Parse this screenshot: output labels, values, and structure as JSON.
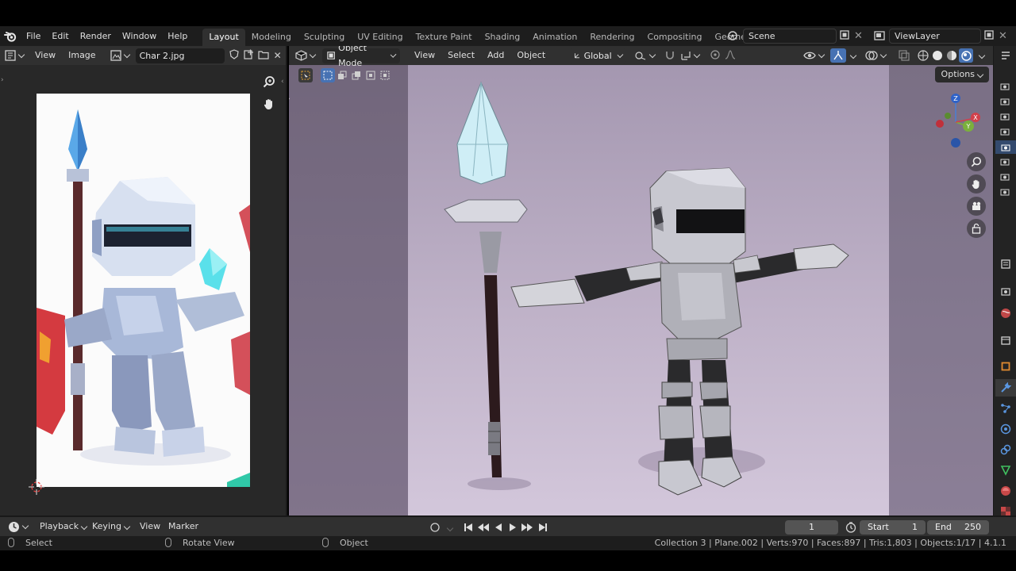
{
  "topbar": {
    "menus": [
      "File",
      "Edit",
      "Render",
      "Window",
      "Help"
    ],
    "workspaces": [
      "Layout",
      "Modeling",
      "Sculpting",
      "UV Editing",
      "Texture Paint",
      "Shading",
      "Animation",
      "Rendering",
      "Compositing",
      "Geomet"
    ],
    "active_workspace": "Layout",
    "scene": "Scene",
    "view_layer": "ViewLayer"
  },
  "image_editor": {
    "menus": [
      "View",
      "Image"
    ],
    "image_name": "Char 2.jpg"
  },
  "viewport": {
    "mode": "Object Mode",
    "menus": [
      "View",
      "Select",
      "Add",
      "Object"
    ],
    "transform_orientation": "Global",
    "options_label": "Options",
    "gizmo_axes": [
      "Z",
      "Y",
      "X"
    ]
  },
  "timeline": {
    "menus": [
      "Playback",
      "Keying",
      "View",
      "Marker"
    ],
    "current_frame": "1",
    "start_label": "Start",
    "start_value": "1",
    "end_label": "End",
    "end_value": "250"
  },
  "statusbar": {
    "select": "Select",
    "rotate_view": "Rotate View",
    "object": "Object",
    "stats": "Collection 3 | Plane.002 | Verts:970 | Faces:897 | Tris:1,803 | Objects:1/17 | 4.1.1"
  },
  "colors": {
    "accent_blue": "#4772b3",
    "header": "#303030",
    "topbar": "#1d1d1d"
  }
}
